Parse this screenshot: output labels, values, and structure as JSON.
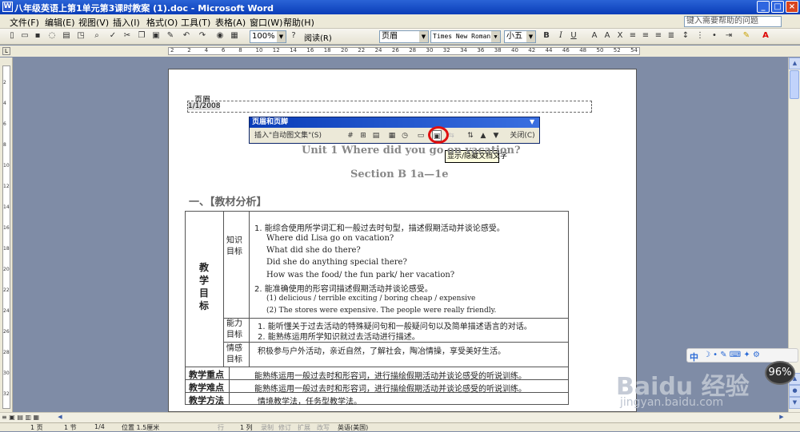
{
  "window": {
    "title": "八年级英语上第1单元第3课时教案 (1).doc - Microsoft Word",
    "minimize": "_",
    "maximize": "□",
    "close": "×"
  },
  "menu": [
    "文件(F)",
    "编辑(E)",
    "视图(V)",
    "插入(I)",
    "格式(O)",
    "工具(T)",
    "表格(A)",
    "窗口(W)",
    "帮助(H)"
  ],
  "help_placeholder": "键入需要帮助的问题",
  "toolbar": {
    "zoom": "100%",
    "read_label": "阅读(R)",
    "style": "页眉",
    "font": "Times New Roman",
    "size": "小五",
    "bold": "B",
    "italic": "I",
    "underline": "U"
  },
  "ruler": {
    "h_ticks": [
      "2",
      "2",
      "4",
      "6",
      "8",
      "10",
      "12",
      "14",
      "16",
      "18",
      "20",
      "22",
      "24",
      "26",
      "28",
      "30",
      "32",
      "34",
      "36",
      "38",
      "40",
      "42",
      "44",
      "46",
      "48",
      "50",
      "52",
      "54"
    ],
    "v_ticks": [
      "2",
      "4",
      "6",
      "8",
      "10",
      "12",
      "14",
      "16",
      "18",
      "20",
      "22",
      "24",
      "26",
      "28",
      "30",
      "32"
    ]
  },
  "page": {
    "header_label": "页眉",
    "header_text": "1/1/2008"
  },
  "hf_toolbar": {
    "title": "页眉和页脚",
    "insert_autotext": "插入\"自动图文集\"(S)",
    "close": "关闭(C)",
    "tooltip": "显示/隐藏文档文字"
  },
  "document": {
    "title": "Unit 1 Where did you go on vacation?",
    "subtitle": "Section B 1a—1e",
    "section_heading": "一、【教材分析】",
    "goals_label": "教学目标",
    "knowledge_label": "知识目标",
    "ability_label": "能力目标",
    "emotion_label": "情感目标",
    "knowledge_lines": [
      "1. 能综合使用所学词汇和一般过去时句型，描述假期活动并谈论感受。",
      "Where did Lisa go on vacation?",
      "What did she do there?",
      "Did she do anything special there?",
      "How was the food/ the fun park/ her vacation?",
      "2. 能准确使用的形容词描述假期活动并谈论感受。",
      "(1) delicious / terrible        exciting / boring        cheap / expensive",
      "(2) The stores were expensive. The people were really friendly."
    ],
    "ability_lines": [
      "1. 能听懂关于过去活动的特殊疑问句和一般疑问句以及简单描述语言的对话。",
      "2. 能熟练运用所学知识就过去活动进行描述。"
    ],
    "emotion_line": "积极参与户外活动，亲近自然，了解社会，陶冶情操，享受美好生活。",
    "key_point_label": "教学重点",
    "key_point": "能熟练运用一般过去时和形容词，进行描绘假期活动并谈论感受的听说训练。",
    "difficulty_label": "教学难点",
    "difficulty": "能熟练运用一般过去时和形容词，进行描绘假期活动并谈论感受的听说训练。",
    "method_label": "教学方法",
    "method": "情境教学法，任务型教学法。"
  },
  "status": {
    "page": "1 页",
    "section": "1 节",
    "count": "1/4",
    "position": "位置 1.5厘米",
    "line": "行",
    "column": "1 列",
    "rec": "录制",
    "trk": "修订",
    "ext": "扩展",
    "ovr": "改写",
    "lang": "英语(美国)"
  },
  "watermark": {
    "brand": "Baidu 经验",
    "url": "jingyan.baidu.com",
    "ime": "中",
    "percent": "96%"
  }
}
